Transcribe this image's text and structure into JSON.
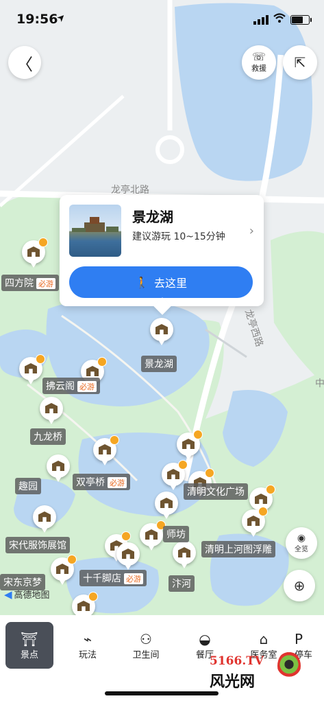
{
  "status_bar": {
    "time": "19:56",
    "location_arrow": "➤",
    "signal_icon": "signal-icon",
    "wifi_icon": "wifi-icon",
    "battery_icon": "battery-icon"
  },
  "top_controls": {
    "back_symbol": "〈",
    "rescue_label": "救援",
    "rescue_symbol": "☏",
    "share_symbol": "⇱"
  },
  "map": {
    "road_labels": [
      "龙亭北路",
      "龙亭西路",
      "中"
    ],
    "colors": {
      "water": "#b9d6f2",
      "park": "#d4efd3",
      "land": "#eceff1",
      "road": "#ffffff"
    }
  },
  "info_card": {
    "title": "景龙湖",
    "subtitle": "建议游玩 10~15分钟",
    "chevron": "›",
    "go_button_label": "去这里",
    "walker_symbol": "🚶"
  },
  "scenic_spots": [
    {
      "name": "四方院",
      "must": "必游"
    },
    {
      "name": "景龙湖",
      "must": ""
    },
    {
      "name": "拂云阁",
      "must": "必游"
    },
    {
      "name": "九龙桥",
      "must": ""
    },
    {
      "name": "趣园",
      "must": ""
    },
    {
      "name": "双亭桥",
      "must": "必游"
    },
    {
      "name": "清明文化广场",
      "must": ""
    },
    {
      "name": "宋代服饰展馆",
      "must": ""
    },
    {
      "name": "师坊",
      "must": ""
    },
    {
      "name": "清明上河图浮雕",
      "must": ""
    },
    {
      "name": "十千脚店",
      "must": "必游"
    },
    {
      "name": "汴河",
      "must": ""
    },
    {
      "name": "宋东京梦",
      "must": ""
    }
  ],
  "map_source": "高德地图",
  "float_buttons": {
    "overview_label": "全览",
    "overview_symbol": "◉",
    "locate_symbol": "⊕"
  },
  "bottom_tabs": [
    {
      "label": "景点",
      "icon": "gate-icon",
      "symbol": "⛩",
      "active": true
    },
    {
      "label": "玩法",
      "icon": "route-icon",
      "symbol": "⌁",
      "active": false
    },
    {
      "label": "卫生间",
      "icon": "toilet-icon",
      "symbol": "⚇",
      "active": false
    },
    {
      "label": "餐厅",
      "icon": "bowl-icon",
      "symbol": "◒",
      "active": false
    },
    {
      "label": "医务室",
      "icon": "clinic-icon",
      "symbol": "⌂",
      "active": false
    },
    {
      "label": "停车",
      "icon": "parking-icon",
      "symbol": "P",
      "active": false
    }
  ],
  "watermark": {
    "site": "5166.TV",
    "brand": "风光网"
  }
}
